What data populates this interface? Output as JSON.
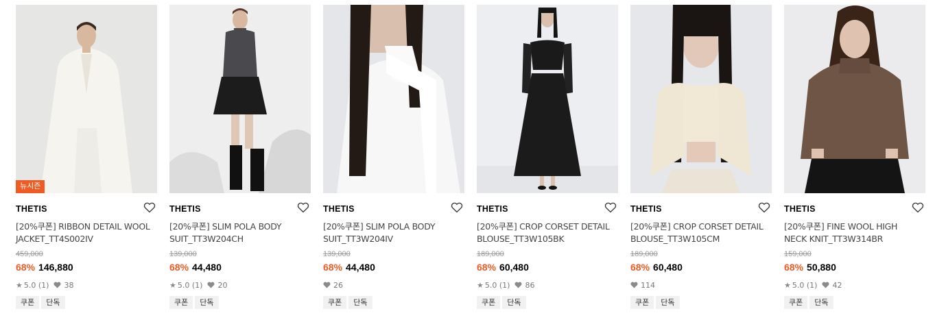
{
  "products": [
    {
      "badge": "뉴시즌",
      "brand": "THETIS",
      "name": "[20%쿠폰] RIBBON DETAIL WOOL JACKET_TT4S002IV",
      "original_price": "459,000",
      "discount": "68%",
      "price": "146,880",
      "rating": "5.0 (1)",
      "likes": "38",
      "tags": [
        "쿠폰",
        "단독"
      ]
    },
    {
      "brand": "THETIS",
      "name": "[20%쿠폰] SLIM POLA BODY SUIT_TT3W204CH",
      "original_price": "139,000",
      "discount": "68%",
      "price": "44,480",
      "rating": "5.0 (1)",
      "likes": "20",
      "tags": [
        "쿠폰",
        "단독"
      ]
    },
    {
      "brand": "THETIS",
      "name": "[20%쿠폰] SLIM POLA BODY SUIT_TT3W204IV",
      "original_price": "139,000",
      "discount": "68%",
      "price": "44,480",
      "likes": "26",
      "tags": [
        "쿠폰",
        "단독"
      ]
    },
    {
      "brand": "THETIS",
      "name": "[20%쿠폰] CROP CORSET DETAIL BLOUSE_TT3W105BK",
      "original_price": "189,000",
      "discount": "68%",
      "price": "60,480",
      "rating": "5.0 (1)",
      "likes": "86",
      "tags": [
        "쿠폰",
        "단독"
      ]
    },
    {
      "brand": "THETIS",
      "name": "[20%쿠폰] CROP CORSET DETAIL BLOUSE_TT3W105CM",
      "original_price": "189,000",
      "discount": "68%",
      "price": "60,480",
      "likes": "114",
      "tags": [
        "쿠폰",
        "단독"
      ]
    },
    {
      "brand": "THETIS",
      "name": "[20%쿠폰] FINE WOOL HIGH NECK KNIT_TT3W314BR",
      "original_price": "159,000",
      "discount": "68%",
      "price": "50,880",
      "rating": "5.0 (1)",
      "likes": "42",
      "tags": [
        "쿠폰",
        "단독"
      ]
    }
  ],
  "colors": {
    "accent": "#f05a23",
    "muted": "#999999",
    "tag_bg": "#f1f1f1"
  }
}
